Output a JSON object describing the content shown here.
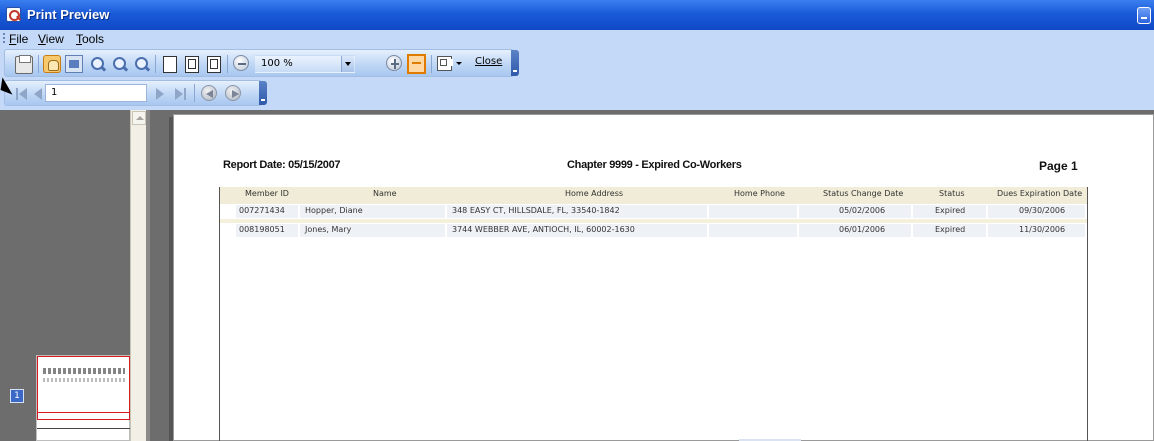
{
  "window": {
    "title": "Print Preview"
  },
  "menu": {
    "items": [
      "File",
      "View",
      "Tools"
    ]
  },
  "toolbar": {
    "zoom_value": "100 %",
    "close_label": "Close"
  },
  "nav": {
    "page_number": "1"
  },
  "thumbnails": {
    "page_badge": "1"
  },
  "report": {
    "date_label": "Report Date: 05/15/2007",
    "title": "Chapter 9999 - Expired Co-Workers",
    "page_label": "Page 1",
    "columns": [
      "Member ID",
      "Name",
      "Home Address",
      "Home Phone",
      "Status Change Date",
      "Status",
      "Dues Expiration Date"
    ],
    "rows": [
      [
        "007271434",
        "Hopper, Diane",
        "348 EASY CT, HILLSDALE, FL, 33540-1842",
        "",
        "05/02/2006",
        "Expired",
        "09/30/2006"
      ],
      [
        "008198051",
        "Jones, Mary",
        "3744 WEBBER AVE, ANTIOCH, IL, 60002-1630",
        "",
        "06/01/2006",
        "Expired",
        "11/30/2006"
      ]
    ]
  },
  "colors": {
    "titlebar": "#1a5ad8",
    "toolbar_bg": "#c3d9f7",
    "header_bg": "#f0ecd7",
    "cell_bg": "#eef1f6",
    "selection_red": "#d81a1a"
  }
}
